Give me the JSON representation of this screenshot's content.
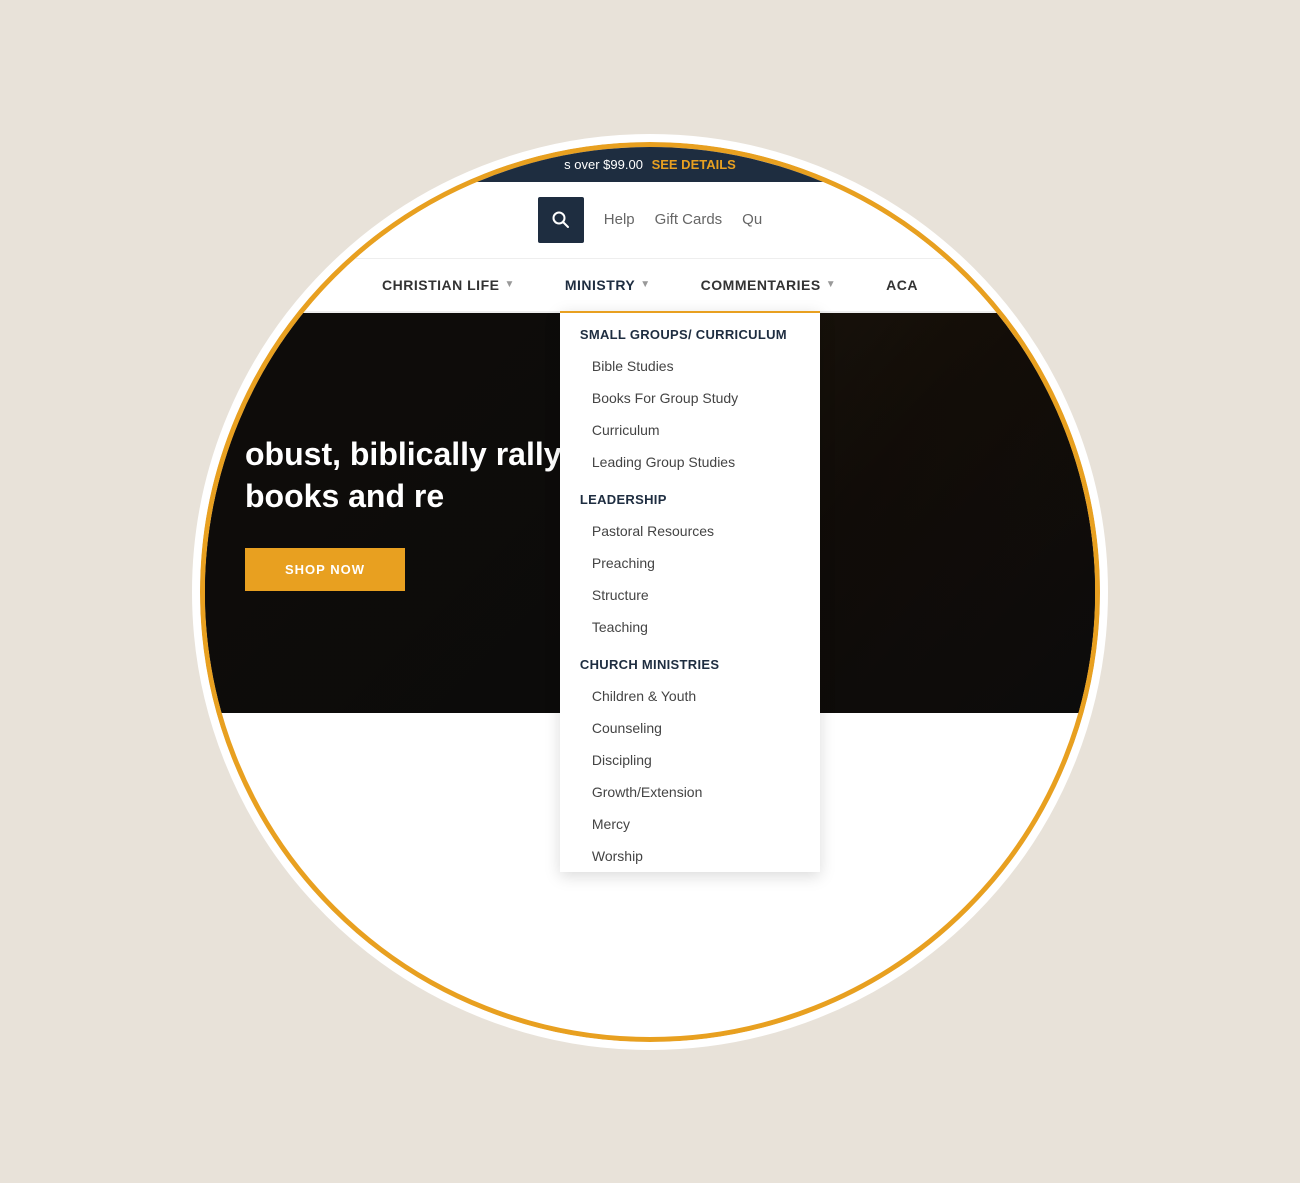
{
  "announcement": {
    "text": "s over $99.00",
    "cta": "SEE DETAILS"
  },
  "header": {
    "help_label": "Help",
    "gift_cards_label": "Gift Cards",
    "other_label": "Qu"
  },
  "nav": {
    "items": [
      {
        "id": "christian-life",
        "label": "CHRISTIAN LIFE",
        "has_dropdown": true
      },
      {
        "id": "ministry",
        "label": "MINISTRY",
        "has_dropdown": true,
        "active": true
      },
      {
        "id": "commentaries",
        "label": "COMMENTARIES",
        "has_dropdown": true
      },
      {
        "id": "aca",
        "label": "ACA",
        "has_dropdown": false
      }
    ]
  },
  "ministry_dropdown": {
    "sections": [
      {
        "id": "small-groups",
        "header": "SMALL GROUPS/ CURRICULUM",
        "items": [
          "Bible Studies",
          "Books For Group Study",
          "Curriculum",
          "Leading Group Studies"
        ]
      },
      {
        "id": "leadership",
        "header": "LEADERSHIP",
        "items": [
          "Pastoral Resources",
          "Preaching",
          "Structure",
          "Teaching"
        ]
      },
      {
        "id": "church-ministries",
        "header": "CHURCH MINISTRIES",
        "items": [
          "Children & Youth",
          "Counseling",
          "Discipling",
          "Growth/Extension",
          "Mercy",
          "Worship"
        ]
      }
    ]
  },
  "hero": {
    "title_start": "obust, biblically r",
    "title_mid": "ally relevant",
    "title_end": "books and re",
    "shop_now": "SHOP NOW"
  },
  "hero_dots": [
    {
      "active": true
    },
    {
      "active": false
    },
    {
      "active": false
    }
  ]
}
